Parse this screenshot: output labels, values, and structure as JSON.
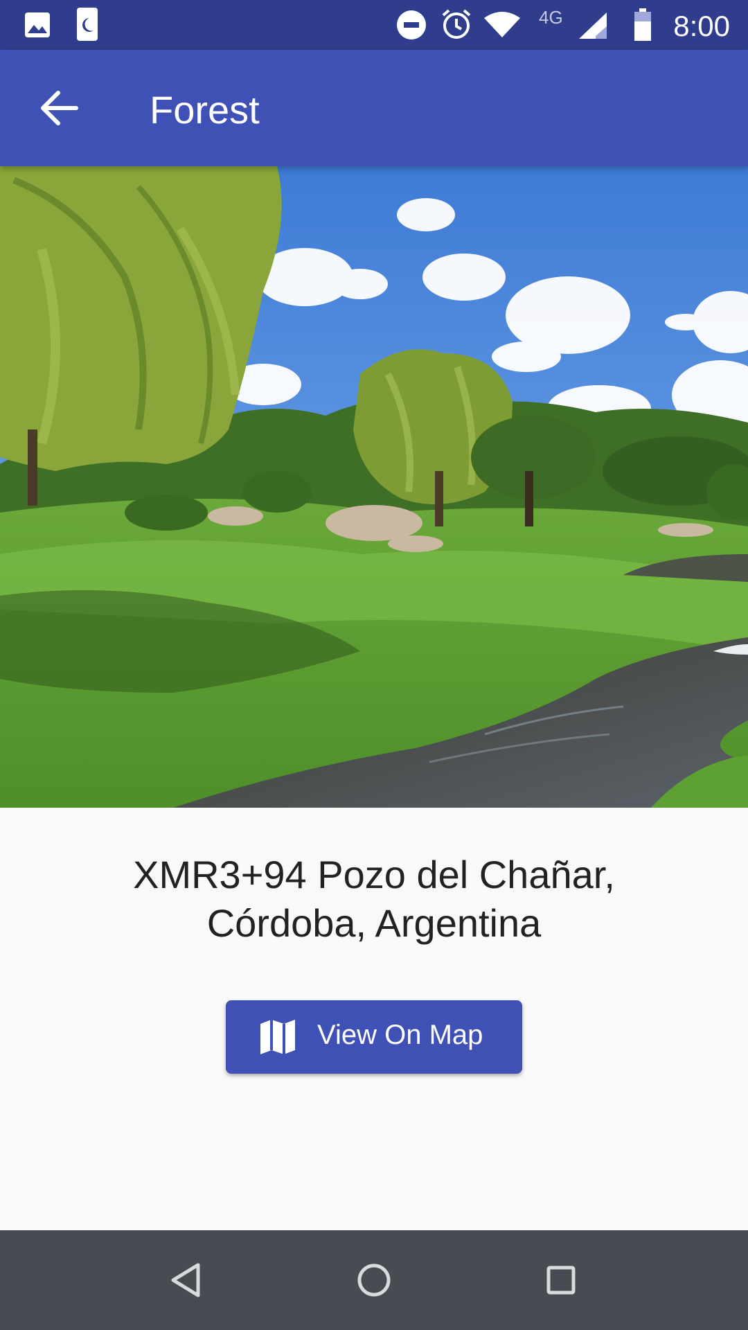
{
  "status_bar": {
    "time": "8:00",
    "network": "4G",
    "icons": [
      "image-icon",
      "sim-moon-icon",
      "do-not-disturb-icon",
      "alarm-icon",
      "wifi-icon",
      "signal-icon",
      "battery-icon"
    ]
  },
  "app_bar": {
    "title": "Forest",
    "back_icon": "arrow-back-icon"
  },
  "hero_image": {
    "subject": "river-meadow-willows"
  },
  "place": {
    "address": "XMR3+94 Pozo del Chañar,\nCórdoba, Argentina"
  },
  "actions": {
    "view_on_map_label": "View On Map",
    "view_on_map_icon": "map-icon"
  },
  "nav_bar": {
    "buttons": [
      "back-triangle-icon",
      "home-circle-icon",
      "recents-square-icon"
    ]
  },
  "colors": {
    "primary": "#3f51b5",
    "primary_dark": "#2f3d8c",
    "nav_bar": "#464c52",
    "background": "#f9f9f9",
    "text": "#222222"
  }
}
